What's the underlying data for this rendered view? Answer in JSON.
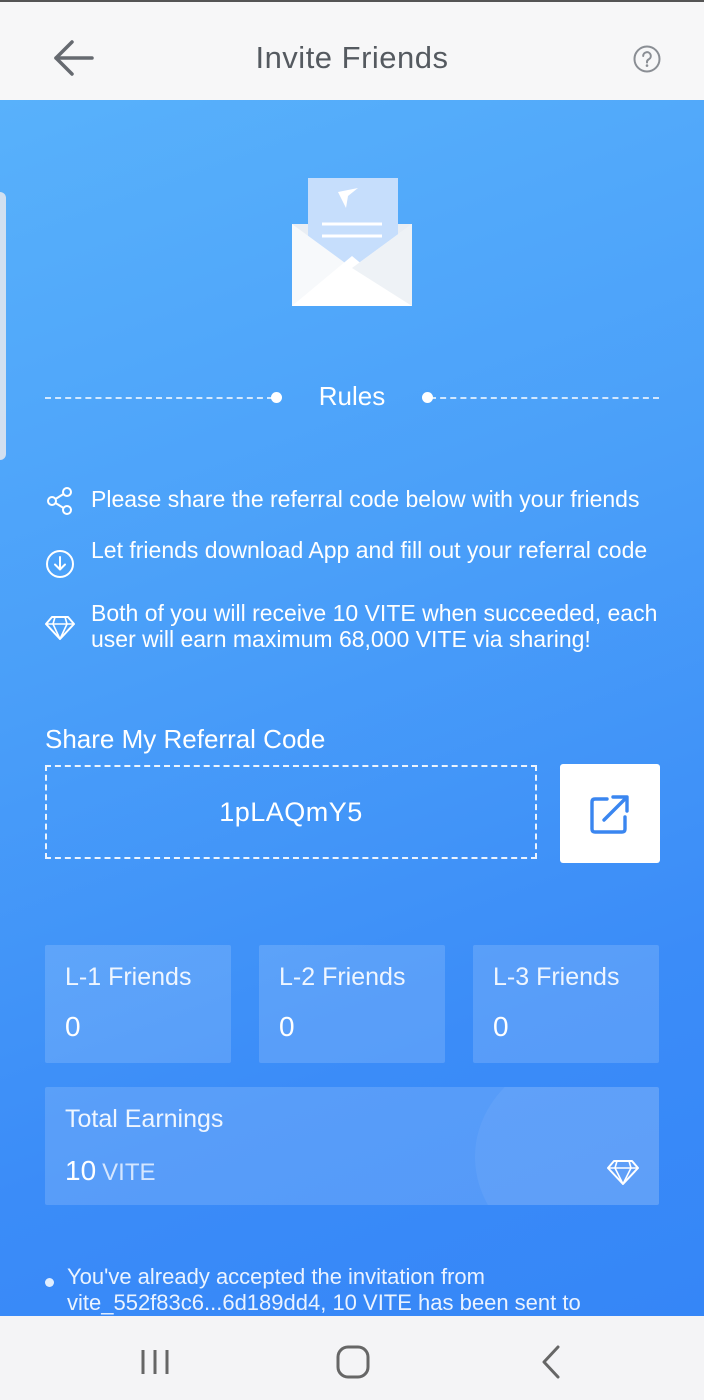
{
  "header": {
    "title": "Invite Friends"
  },
  "rules": {
    "title": "Rules",
    "items": [
      {
        "icon": "share-icon",
        "text": "Please share the referral code below with your friends"
      },
      {
        "icon": "download-icon",
        "text": "Let friends download App and fill out your referral code"
      },
      {
        "icon": "diamond-icon",
        "text": "Both of you will receive 10 VITE when succeeded, each user will earn maximum 68,000 VITE via sharing!"
      }
    ]
  },
  "referral": {
    "label": "Share My Referral Code",
    "code": "1pLAQmY5"
  },
  "stats": [
    {
      "label": "L-1 Friends",
      "value": "0"
    },
    {
      "label": "L-2 Friends",
      "value": "0"
    },
    {
      "label": "L-3 Friends",
      "value": "0"
    }
  ],
  "earnings": {
    "label": "Total Earnings",
    "value": "10",
    "unit": "VITE"
  },
  "notice": {
    "text": "You've already accepted the invitation from vite_552f83c6...6d189dd4, 10 VITE has been sent to"
  },
  "colors": {
    "gradient_start": "#58b1fb",
    "gradient_end": "#3586f7",
    "accent": "#3a86f0",
    "header_bg": "#f7f7f8",
    "title_text": "#555a60"
  }
}
